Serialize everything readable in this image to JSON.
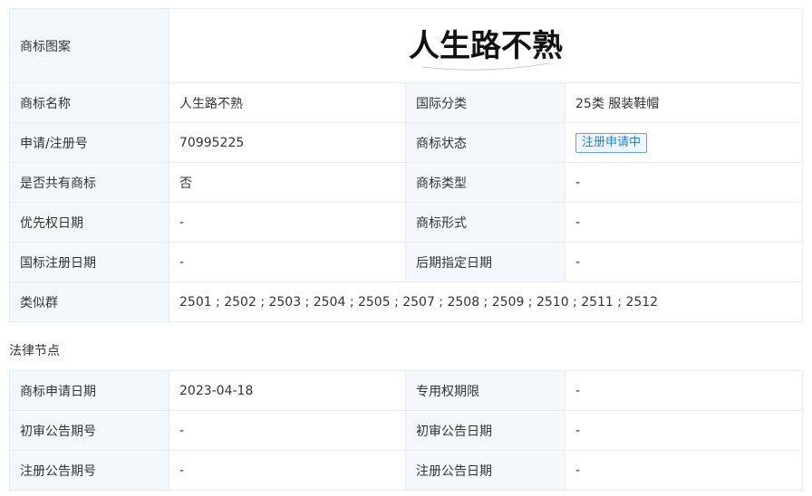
{
  "basic": {
    "image_label": "商标图案",
    "logo_text": "人生路不熟",
    "name_label": "商标名称",
    "name_value": "人生路不熟",
    "class_label": "国际分类",
    "class_value": "25类 服装鞋帽",
    "reg_label": "申请/注册号",
    "reg_value": "70995225",
    "status_label": "商标状态",
    "status_value": "注册申请中",
    "shared_label": "是否共有商标",
    "shared_value": "否",
    "type_label": "商标类型",
    "type_value": "-",
    "priority_label": "优先权日期",
    "priority_value": "-",
    "form_label": "商标形式",
    "form_value": "-",
    "intl_label": "国标注册日期",
    "intl_value": "-",
    "later_label": "后期指定日期",
    "later_value": "-",
    "similar_label": "类似群",
    "similar_value": "2501 ; 2502 ; 2503 ; 2504 ; 2505 ; 2507 ; 2508 ; 2509 ; 2510 ; 2511 ; 2512"
  },
  "legal": {
    "section_title": "法律节点",
    "apply_date_label": "商标申请日期",
    "apply_date_value": "2023-04-18",
    "exclusive_label": "专用权期限",
    "exclusive_value": "-",
    "prelim_no_label": "初审公告期号",
    "prelim_no_value": "-",
    "prelim_date_label": "初审公告日期",
    "prelim_date_value": "-",
    "reg_no_label": "注册公告期号",
    "reg_no_value": "-",
    "reg_date_label": "注册公告日期",
    "reg_date_value": "-"
  },
  "colors": {
    "label_bg": "#f3f8fc",
    "border": "#e6ecf2",
    "status_blue": "#1f7fd6"
  }
}
